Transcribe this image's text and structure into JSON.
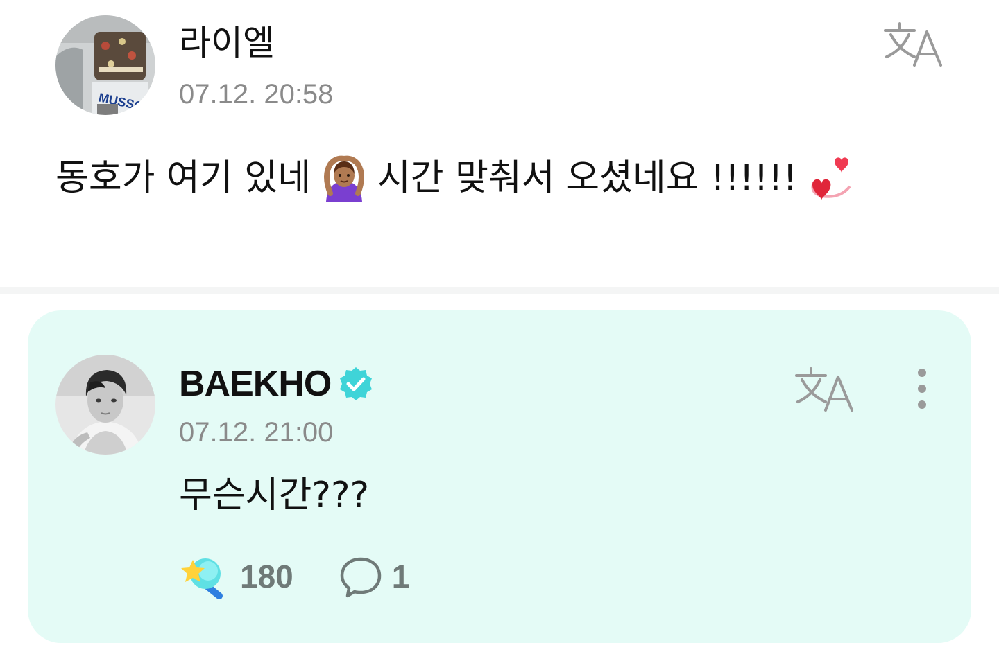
{
  "post": {
    "username": "라이엘",
    "timestamp": "07.12. 20:58",
    "body_part1": "동호가 여기 있네",
    "body_part2": "시간 맞춰서 오셨네요 !!!!!!",
    "emoji_1": "woman-gesturing-ok-icon",
    "emoji_2": "revolving-hearts-icon",
    "avatar": "user-avatar-bag-photo",
    "translate_icon": "translate-icon"
  },
  "comment": {
    "username": "BAEKHO",
    "verified_icon": "verified-badge-icon",
    "timestamp": "07.12. 21:00",
    "text": "무슨시간???",
    "reaction_count": "180",
    "reply_count": "1",
    "reaction_icon": "lightstick-star-icon",
    "reply_icon": "speech-bubble-icon",
    "translate_icon": "translate-icon",
    "more_icon": "more-vertical-icon"
  },
  "colors": {
    "card_background": "#e4fbf6",
    "verified": "#3fd4d8",
    "timestamp": "#8a8a8a",
    "count": "#6f7a78"
  }
}
